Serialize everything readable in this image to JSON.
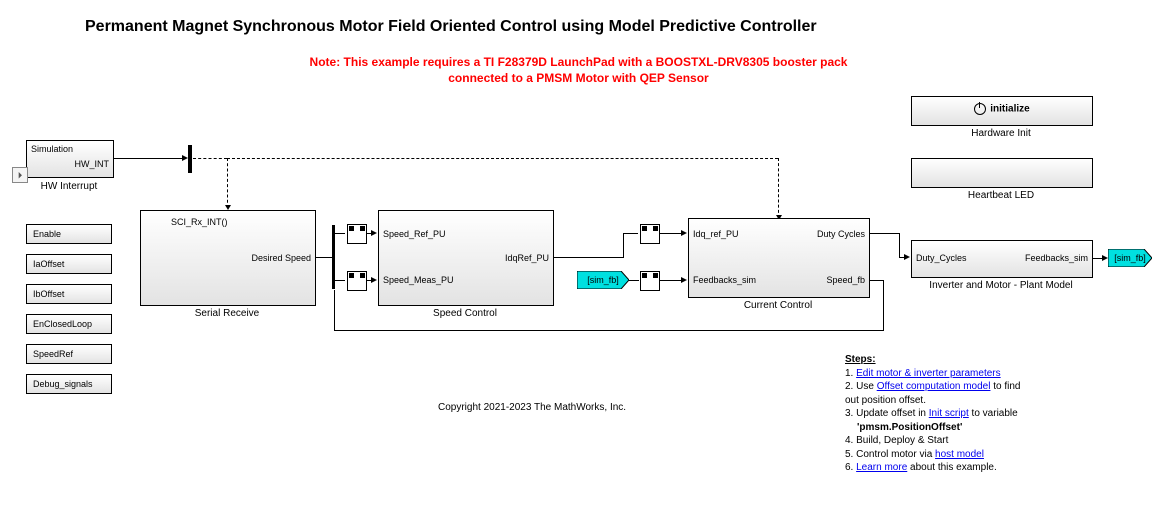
{
  "title": "Permanent Magnet Synchronous Motor Field Oriented Control using Model Predictive Controller",
  "note_line1": "Note: This example requires a TI F28379D LaunchPad with a BOOSTXL-DRV8305 booster pack",
  "note_line2": "connected to a PMSM Motor with QEP Sensor",
  "copyright": "Copyright 2021-2023 The MathWorks, Inc.",
  "hw_interrupt": {
    "inner_top": "Simulation",
    "port_out": "HW_INT",
    "label": "HW Interrupt"
  },
  "data_stores": {
    "items": [
      {
        "label": "Enable"
      },
      {
        "label": "IaOffset"
      },
      {
        "label": "IbOffset"
      },
      {
        "label": "EnClosedLoop"
      },
      {
        "label": "SpeedRef"
      },
      {
        "label": "Debug_signals"
      }
    ]
  },
  "serial_receive": {
    "title_inner": "SCI_Rx_INT()",
    "port_out": "Desired Speed",
    "label": "Serial Receive"
  },
  "speed_control": {
    "in1": "Speed_Ref_PU",
    "in2": "Speed_Meas_PU",
    "out": "IdqRef_PU",
    "label": "Speed Control"
  },
  "current_control": {
    "in1": "Idq_ref_PU",
    "in2": "Feedbacks_sim",
    "out1": "Duty Cycles",
    "out2": "Speed_fb",
    "label": "Current Control"
  },
  "plant": {
    "in": "Duty_Cycles",
    "out": "Feedbacks_sim",
    "label": "Inverter and Motor - Plant Model"
  },
  "hw_init": {
    "text": "initialize",
    "label": "Hardware Init"
  },
  "heartbeat": {
    "label": "Heartbeat LED"
  },
  "from_tag": {
    "text": "[sim_fb]"
  },
  "goto_tag": {
    "text": "[sim_fb]"
  },
  "badge": "⏵",
  "steps": {
    "header": "Steps:",
    "l1a": "1. ",
    "l1b": "Edit motor & inverter parameters",
    "l2a": "2. Use ",
    "l2b": "Offset computation model",
    "l2c": " to find",
    "l2d": "out position offset.",
    "l3a": "3. Update offset in ",
    "l3b": "Init script",
    "l3c": " to variable",
    "l3d": "'pmsm.PositionOffset'",
    "l4": "4. Build, Deploy & Start",
    "l5a": "5. Control motor via ",
    "l5b": "host model",
    "l6a": "6. ",
    "l6b": "Learn more",
    "l6c": " about this example."
  }
}
